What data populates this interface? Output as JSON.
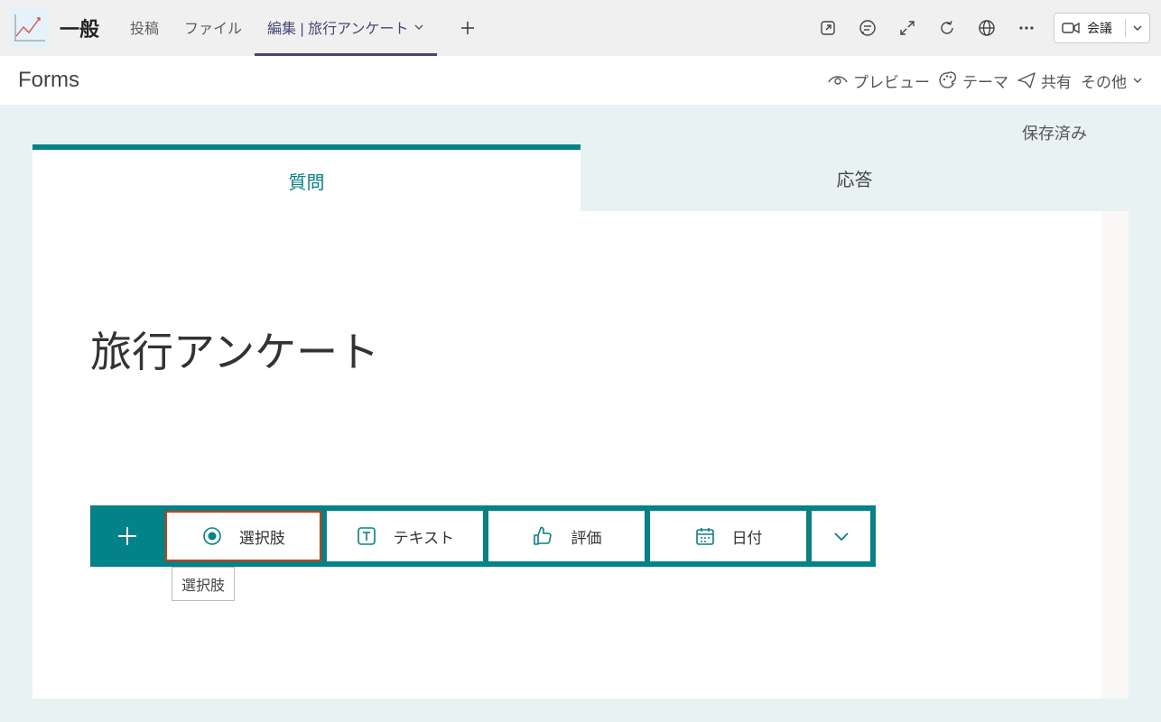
{
  "teams": {
    "channel": "一般",
    "tabs": {
      "posts": "投稿",
      "files": "ファイル",
      "edit": "編集 | 旅行アンケート"
    },
    "meet": "会議"
  },
  "forms": {
    "brand": "Forms",
    "preview": "プレビュー",
    "theme": "テーマ",
    "share": "共有",
    "other": "その他",
    "saved": "保存済み"
  },
  "form": {
    "tab_questions": "質問",
    "tab_responses": "応答",
    "title": "旅行アンケート"
  },
  "addq": {
    "choice": "選択肢",
    "text": "テキスト",
    "rating": "評価",
    "date": "日付",
    "tooltip": "選択肢"
  }
}
